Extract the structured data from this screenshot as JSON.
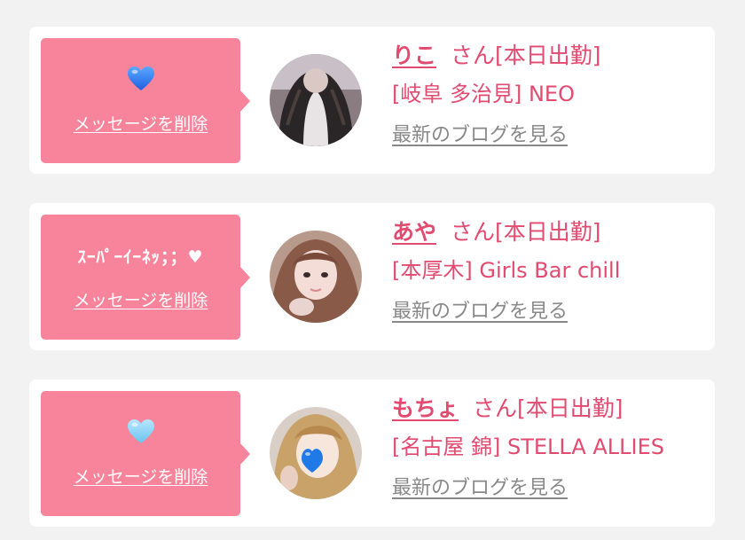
{
  "colors": {
    "background": "#f2f2f3",
    "card": "#ffffff",
    "accent_pink": "#e24a70",
    "message_box": "#f7849a",
    "blog_link_gray": "#888888"
  },
  "cards": [
    {
      "message": "💙",
      "message_icon": "blue-heart-icon",
      "delete_label": "メッセージを削除",
      "name": "りこ",
      "suffix": "さん[本日出勤]",
      "shop": "[岐阜 多治見] NEO",
      "blog_label": "最新のブログを見る"
    },
    {
      "message": "ｽｰﾊﾟｰｲｰﾈｯ；；♥",
      "delete_label": "メッセージを削除",
      "name": "あや",
      "suffix": "さん[本日出勤]",
      "shop": "[本厚木] Girls Bar chill",
      "blog_label": "最新のブログを見る"
    },
    {
      "message": "🩵",
      "message_icon": "light-blue-heart-icon",
      "delete_label": "メッセージを削除",
      "name": "もちょ",
      "suffix": "さん[本日出勤]",
      "shop": "[名古屋 錦] STELLA ALLIES",
      "blog_label": "最新のブログを見る"
    }
  ]
}
